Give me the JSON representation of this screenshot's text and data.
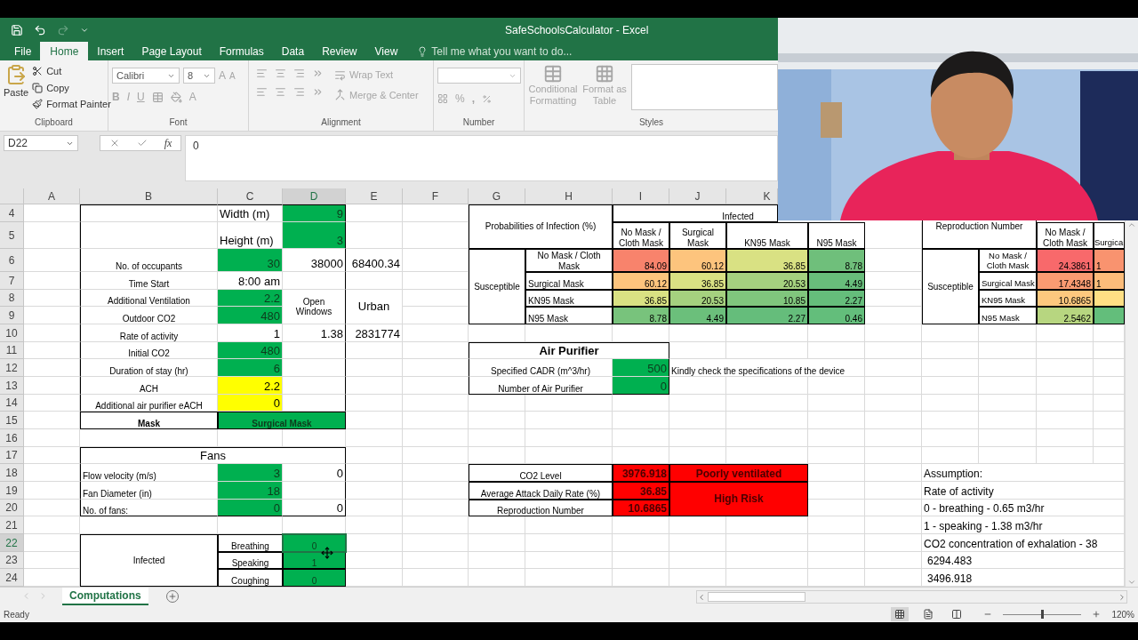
{
  "title_bar": {
    "title": "SafeSchoolsCalculator - Excel"
  },
  "quick_access": [
    {
      "kind": "save",
      "disabled": false
    },
    {
      "kind": "undo",
      "disabled": false
    },
    {
      "kind": "redo",
      "disabled": true
    },
    {
      "kind": "customize",
      "disabled": false
    }
  ],
  "tabs": [
    {
      "label": "File",
      "selected": false
    },
    {
      "label": "Home",
      "selected": true
    },
    {
      "label": "Insert",
      "selected": false
    },
    {
      "label": "Page Layout",
      "selected": false
    },
    {
      "label": "Formulas",
      "selected": false
    },
    {
      "label": "Data",
      "selected": false
    },
    {
      "label": "Review",
      "selected": false
    },
    {
      "label": "View",
      "selected": false
    }
  ],
  "tell_me": {
    "placeholder": "Tell me what you want to do..."
  },
  "ribbon": {
    "clipboard": {
      "label": "Clipboard",
      "disabled": false,
      "paste": "Paste",
      "cut": "Cut",
      "copy": "Copy",
      "format_painter": "Format Painter"
    },
    "font": {
      "label": "Font",
      "disabled": true,
      "font_name": "Calibri",
      "font_size": "8",
      "grow": "A",
      "shrink": "A",
      "bold": "B",
      "italic": "I",
      "underline": "U",
      "font_color": "A"
    },
    "alignment": {
      "label": "Alignment",
      "disabled": true,
      "wrap_text": "Wrap Text",
      "merge_center": "Merge & Center"
    },
    "number": {
      "label": "Number",
      "disabled": true,
      "percent": "%",
      "comma": ","
    },
    "styles": {
      "label": "Styles",
      "disabled": true,
      "conditional_formatting": [
        "Conditional",
        "Formatting"
      ],
      "format_as_table": [
        "Format as",
        "Table"
      ]
    }
  },
  "formula_bar": {
    "name_box": "D22",
    "function_label": "fx",
    "value": "0"
  },
  "sheet": {
    "columns": [
      "A",
      "B",
      "C",
      "D",
      "E",
      "F",
      "G",
      "H",
      "I",
      "J",
      "K"
    ],
    "rows": [
      "4",
      "5",
      "6",
      "7",
      "8",
      "9",
      "10",
      "11",
      "12",
      "13",
      "14",
      "15",
      "16",
      "17",
      "18",
      "19",
      "20",
      "21",
      "22",
      "23",
      "24"
    ],
    "cells": [
      {
        "text": "Width (m)",
        "kind": "plain",
        "selected": false
      },
      {
        "text": "9",
        "kind": "input",
        "selected": false
      },
      {
        "text": "Height (m)",
        "kind": "plain",
        "selected": false
      },
      {
        "text": "3",
        "kind": "input",
        "selected": false
      },
      {
        "text": "No. of occupants",
        "kind": "plain",
        "selected": false
      },
      {
        "text": "30",
        "kind": "input",
        "selected": false
      },
      {
        "text": "38000",
        "kind": "plain",
        "selected": false
      },
      {
        "text": "68400.34",
        "kind": "plain",
        "selected": false
      },
      {
        "text": "Time Start",
        "kind": "plain",
        "selected": false
      },
      {
        "text": "8:00 am",
        "kind": "plain",
        "selected": false
      },
      {
        "text": "Additional Ventilation",
        "kind": "plain",
        "selected": false
      },
      {
        "text": "2.2",
        "kind": "input",
        "selected": false
      },
      {
        "text": "Open Windows",
        "kind": "plain",
        "selected": false
      },
      {
        "text": "Urban",
        "kind": "plain",
        "selected": false
      },
      {
        "text": "Outdoor CO2",
        "kind": "plain",
        "selected": false
      },
      {
        "text": "480",
        "kind": "input",
        "selected": false
      },
      {
        "text": "Rate of activity",
        "kind": "plain",
        "selected": false
      },
      {
        "text": "1",
        "kind": "plain",
        "selected": false
      },
      {
        "text": "1.38",
        "kind": "plain",
        "selected": false
      },
      {
        "text": "2831774",
        "kind": "plain",
        "selected": false
      },
      {
        "text": "Initial CO2",
        "kind": "plain",
        "selected": false
      },
      {
        "text": "480",
        "kind": "input",
        "selected": false
      },
      {
        "text": "Duration of stay (hr)",
        "kind": "plain",
        "selected": false
      },
      {
        "text": "6",
        "kind": "input",
        "selected": false
      },
      {
        "text": "ACH",
        "kind": "plain",
        "selected": false
      },
      {
        "text": "2.2",
        "kind": "warning",
        "selected": false
      },
      {
        "text": "Additional air purifier eACH",
        "kind": "plain",
        "selected": false
      },
      {
        "text": "0",
        "kind": "warning",
        "selected": false
      },
      {
        "text": "Mask",
        "kind": "plain",
        "selected": false
      },
      {
        "text": "Surgical Mask",
        "kind": "input",
        "selected": false
      },
      {
        "text": "Fans",
        "kind": "plain",
        "selected": false
      },
      {
        "text": "Flow velocity (m/s)",
        "kind": "plain",
        "selected": false
      },
      {
        "text": "3",
        "kind": "input",
        "selected": false
      },
      {
        "text": "0",
        "kind": "plain",
        "selected": false
      },
      {
        "text": "Fan Diameter (in)",
        "kind": "plain",
        "selected": false
      },
      {
        "text": "18",
        "kind": "input",
        "selected": false
      },
      {
        "text": "No. of fans:",
        "kind": "plain",
        "selected": false
      },
      {
        "text": "0",
        "kind": "input",
        "selected": false
      },
      {
        "text": "0",
        "kind": "plain",
        "selected": false
      },
      {
        "text": "Infected",
        "kind": "plain",
        "selected": false
      },
      {
        "text": "Breathing",
        "kind": "plain",
        "selected": false
      },
      {
        "text": "0",
        "kind": "input",
        "selected": true
      },
      {
        "text": "Speaking",
        "kind": "plain",
        "selected": false
      },
      {
        "text": "1",
        "kind": "input",
        "selected": false
      },
      {
        "text": "Coughing",
        "kind": "plain",
        "selected": false
      },
      {
        "text": "0",
        "kind": "input",
        "selected": false
      },
      {
        "text": "Probabilities of Infection (%)",
        "kind": "plain",
        "selected": false
      },
      {
        "text": "Infected",
        "kind": "plain",
        "selected": false
      },
      {
        "text": "No Mask / Cloth Mask",
        "kind": "plain",
        "selected": false
      },
      {
        "text": "Surgical Mask",
        "kind": "plain",
        "selected": false
      },
      {
        "text": "KN95 Mask",
        "kind": "plain",
        "selected": false
      },
      {
        "text": "N95 Mask",
        "kind": "plain",
        "selected": false
      },
      {
        "text": "Susceptible",
        "kind": "plain",
        "selected": false
      },
      {
        "text": "No Mask / Cloth Mask",
        "kind": "plain",
        "selected": false
      },
      {
        "text": "84.09",
        "kind": "heat",
        "color": "#f8836c",
        "selected": false
      },
      {
        "text": "60.12",
        "kind": "heat",
        "color": "#fdc47d",
        "selected": false
      },
      {
        "text": "36.85",
        "kind": "heat",
        "color": "#d9e183",
        "selected": false
      },
      {
        "text": "8.78",
        "kind": "heat",
        "color": "#6fbf7b",
        "selected": false
      },
      {
        "text": "Surgical Mask",
        "kind": "plain",
        "selected": false
      },
      {
        "text": "60.12",
        "kind": "heat",
        "color": "#fdc47d",
        "selected": false
      },
      {
        "text": "36.85",
        "kind": "heat",
        "color": "#d9e183",
        "selected": false
      },
      {
        "text": "20.53",
        "kind": "heat",
        "color": "#a5d17f",
        "selected": false
      },
      {
        "text": "4.49",
        "kind": "heat",
        "color": "#68bd7b",
        "selected": false
      },
      {
        "text": "KN95 Mask",
        "kind": "plain",
        "selected": false
      },
      {
        "text": "36.85",
        "kind": "heat",
        "color": "#d9e183",
        "selected": false
      },
      {
        "text": "20.53",
        "kind": "heat",
        "color": "#a5d17f",
        "selected": false
      },
      {
        "text": "10.85",
        "kind": "heat",
        "color": "#80c67d",
        "selected": false
      },
      {
        "text": "2.27",
        "kind": "heat",
        "color": "#65bd7b",
        "selected": false
      },
      {
        "text": "N95 Mask",
        "kind": "plain",
        "selected": false
      },
      {
        "text": "8.78",
        "kind": "heat",
        "color": "#78c37c",
        "selected": false
      },
      {
        "text": "4.49",
        "kind": "heat",
        "color": "#6bbf7b",
        "selected": false
      },
      {
        "text": "2.27",
        "kind": "heat",
        "color": "#65bd7b",
        "selected": false
      },
      {
        "text": "0.46",
        "kind": "heat",
        "color": "#63be7b",
        "selected": false
      },
      {
        "text": "Reproduction Number",
        "kind": "plain",
        "selected": false
      },
      {
        "text": "No Mask / Cloth Mask",
        "kind": "plain",
        "selected": false
      },
      {
        "text": "Surgica",
        "kind": "plain",
        "selected": false
      },
      {
        "text": "Susceptible",
        "kind": "plain",
        "selected": false
      },
      {
        "text": "No Mask / Cloth Mask",
        "kind": "plain",
        "selected": false
      },
      {
        "text": "24.3861",
        "kind": "heat",
        "color": "#f8696b",
        "selected": false
      },
      {
        "text": "1",
        "kind": "heat",
        "color": "#f9936f",
        "selected": false
      },
      {
        "text": "Surgical Mask",
        "kind": "plain",
        "selected": false
      },
      {
        "text": "17.4348",
        "kind": "heat",
        "color": "#fa9b72",
        "selected": false
      },
      {
        "text": "1",
        "kind": "heat",
        "color": "#fcbc7a",
        "selected": false
      },
      {
        "text": "KN95 Mask",
        "kind": "plain",
        "selected": false
      },
      {
        "text": "10.6865",
        "kind": "heat",
        "color": "#fdc87e",
        "selected": false
      },
      {
        "kind": "heat",
        "color": "#ffdf84",
        "selected": false
      },
      {
        "text": "N95 Mask",
        "kind": "plain",
        "selected": false
      },
      {
        "text": "2.5462",
        "kind": "heat",
        "color": "#b7d680",
        "selected": false
      },
      {
        "kind": "heat",
        "color": "#63be7b",
        "selected": false
      },
      {
        "text": "Air Purifier",
        "kind": "plain",
        "selected": false
      },
      {
        "text": "Specified CADR (m^3/hr)",
        "kind": "plain",
        "selected": false
      },
      {
        "text": "500",
        "kind": "input",
        "selected": false
      },
      {
        "text": "Kindly check the specifications of the device",
        "kind": "plain",
        "selected": false
      },
      {
        "text": "Number of Air Purifier",
        "kind": "plain",
        "selected": false
      },
      {
        "text": "0",
        "kind": "input",
        "selected": false
      },
      {
        "text": "CO2 Level",
        "kind": "plain",
        "selected": false
      },
      {
        "text": "3976.918",
        "kind": "alert",
        "selected": false
      },
      {
        "text": "Poorly ventilated",
        "kind": "alert",
        "selected": false
      },
      {
        "text": "Average Attack Daily Rate (%)",
        "kind": "plain",
        "selected": false
      },
      {
        "text": "36.85",
        "kind": "alert",
        "selected": false
      },
      {
        "text": "High Risk",
        "kind": "alert",
        "selected": false
      },
      {
        "text": "Reproduction Number",
        "kind": "plain",
        "selected": false
      },
      {
        "text": "10.6865",
        "kind": "alert",
        "selected": false
      },
      {
        "text": "Assumption:",
        "kind": "plain",
        "selected": false
      },
      {
        "text": "Rate of activity",
        "kind": "plain",
        "selected": false
      },
      {
        "text": "0 - breathing - 0.65 m3/hr",
        "kind": "plain",
        "selected": false
      },
      {
        "text": "1 - speaking - 1.38 m3/hr",
        "kind": "plain",
        "selected": false
      },
      {
        "text": "CO2 concentration of exhalation - 38",
        "kind": "plain",
        "selected": false
      },
      {
        "text": "6294.483",
        "kind": "plain",
        "selected": false
      },
      {
        "text": "3496.918",
        "kind": "plain",
        "selected": false
      }
    ]
  },
  "sheet_tabs": [
    {
      "label": "Computations",
      "selected": true
    }
  ],
  "status_bar": {
    "text": "Ready",
    "views": [
      {
        "kind": "normal",
        "selected": true
      },
      {
        "kind": "page_layout",
        "selected": false
      },
      {
        "kind": "page_break",
        "selected": false
      }
    ],
    "zoom_slider": {
      "level": 0.5
    },
    "zoom": "120%"
  }
}
